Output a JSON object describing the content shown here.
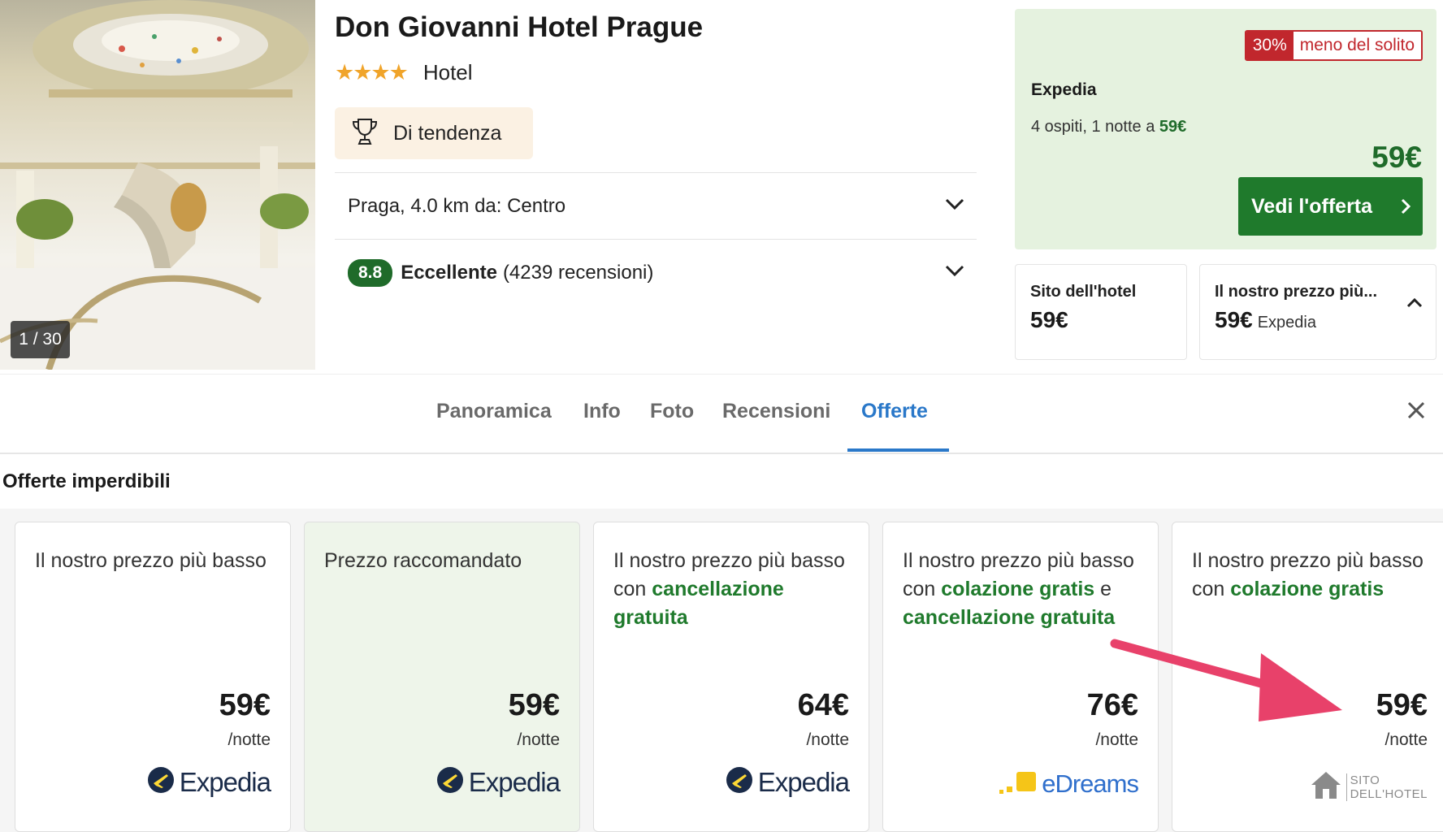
{
  "photo": {
    "counter": "1 / 30"
  },
  "hotel": {
    "name": "Don Giovanni Hotel Prague",
    "stars": "★★★★",
    "type": "Hotel",
    "trend_badge": "Di tendenza",
    "location": "Praga, 4.0 km da: Centro",
    "rating": {
      "score": "8.8",
      "label": "Eccellente",
      "reviews": "(4239 recensioni)"
    }
  },
  "deal": {
    "discount_pct": "30%",
    "discount_label": "meno del solito",
    "provider": "Expedia",
    "desc_prefix": "4 ospiti, 1 notte a ",
    "desc_price": "59€",
    "price": "59€",
    "button": "Vedi l'offerta"
  },
  "mini_cards": [
    {
      "label": "Sito dell'hotel",
      "price": "59€",
      "provider": ""
    },
    {
      "label": "Il nostro prezzo più...",
      "price": "59€",
      "provider": "Expedia"
    }
  ],
  "tabs": [
    "Panoramica",
    "Info",
    "Foto",
    "Recensioni",
    "Offerte"
  ],
  "active_tab": "Offerte",
  "section_title": "Offerte imperdibili",
  "offers": [
    {
      "title_1": "Il nostro prezzo più basso",
      "price": "59€",
      "unit": "/notte",
      "provider": "Expedia"
    },
    {
      "title_1": "Prezzo raccomandato",
      "price": "59€",
      "unit": "/notte",
      "provider": "Expedia"
    },
    {
      "title_1": "Il nostro prezzo più basso con ",
      "title_g1": "cancellazione gratuita",
      "price": "64€",
      "unit": "/notte",
      "provider": "Expedia"
    },
    {
      "title_1": "Il nostro prezzo più basso con ",
      "title_g1": "colazione gratis",
      "title_2": " e ",
      "title_g2": "cancellazione gratuita",
      "price": "76€",
      "unit": "/notte",
      "provider": "eDreams"
    },
    {
      "title_1": "Il nostro prezzo più basso con ",
      "title_g1": "colazione gratis",
      "price": "59€",
      "unit": "/notte",
      "provider_line1": "SITO",
      "provider_line2": "DELL'HOTEL"
    }
  ],
  "colors": {
    "green_brand": "#1f7a2c",
    "active_tab": "#2a78c9",
    "discount_red": "#c1272d",
    "annotation_arrow": "#e8416a"
  },
  "icons": [
    "trophy-icon",
    "chevron-down-icon",
    "chevron-right-icon",
    "chevron-up-icon",
    "close-icon",
    "expedia-logo-icon",
    "edreams-logo-icon",
    "house-icon"
  ]
}
